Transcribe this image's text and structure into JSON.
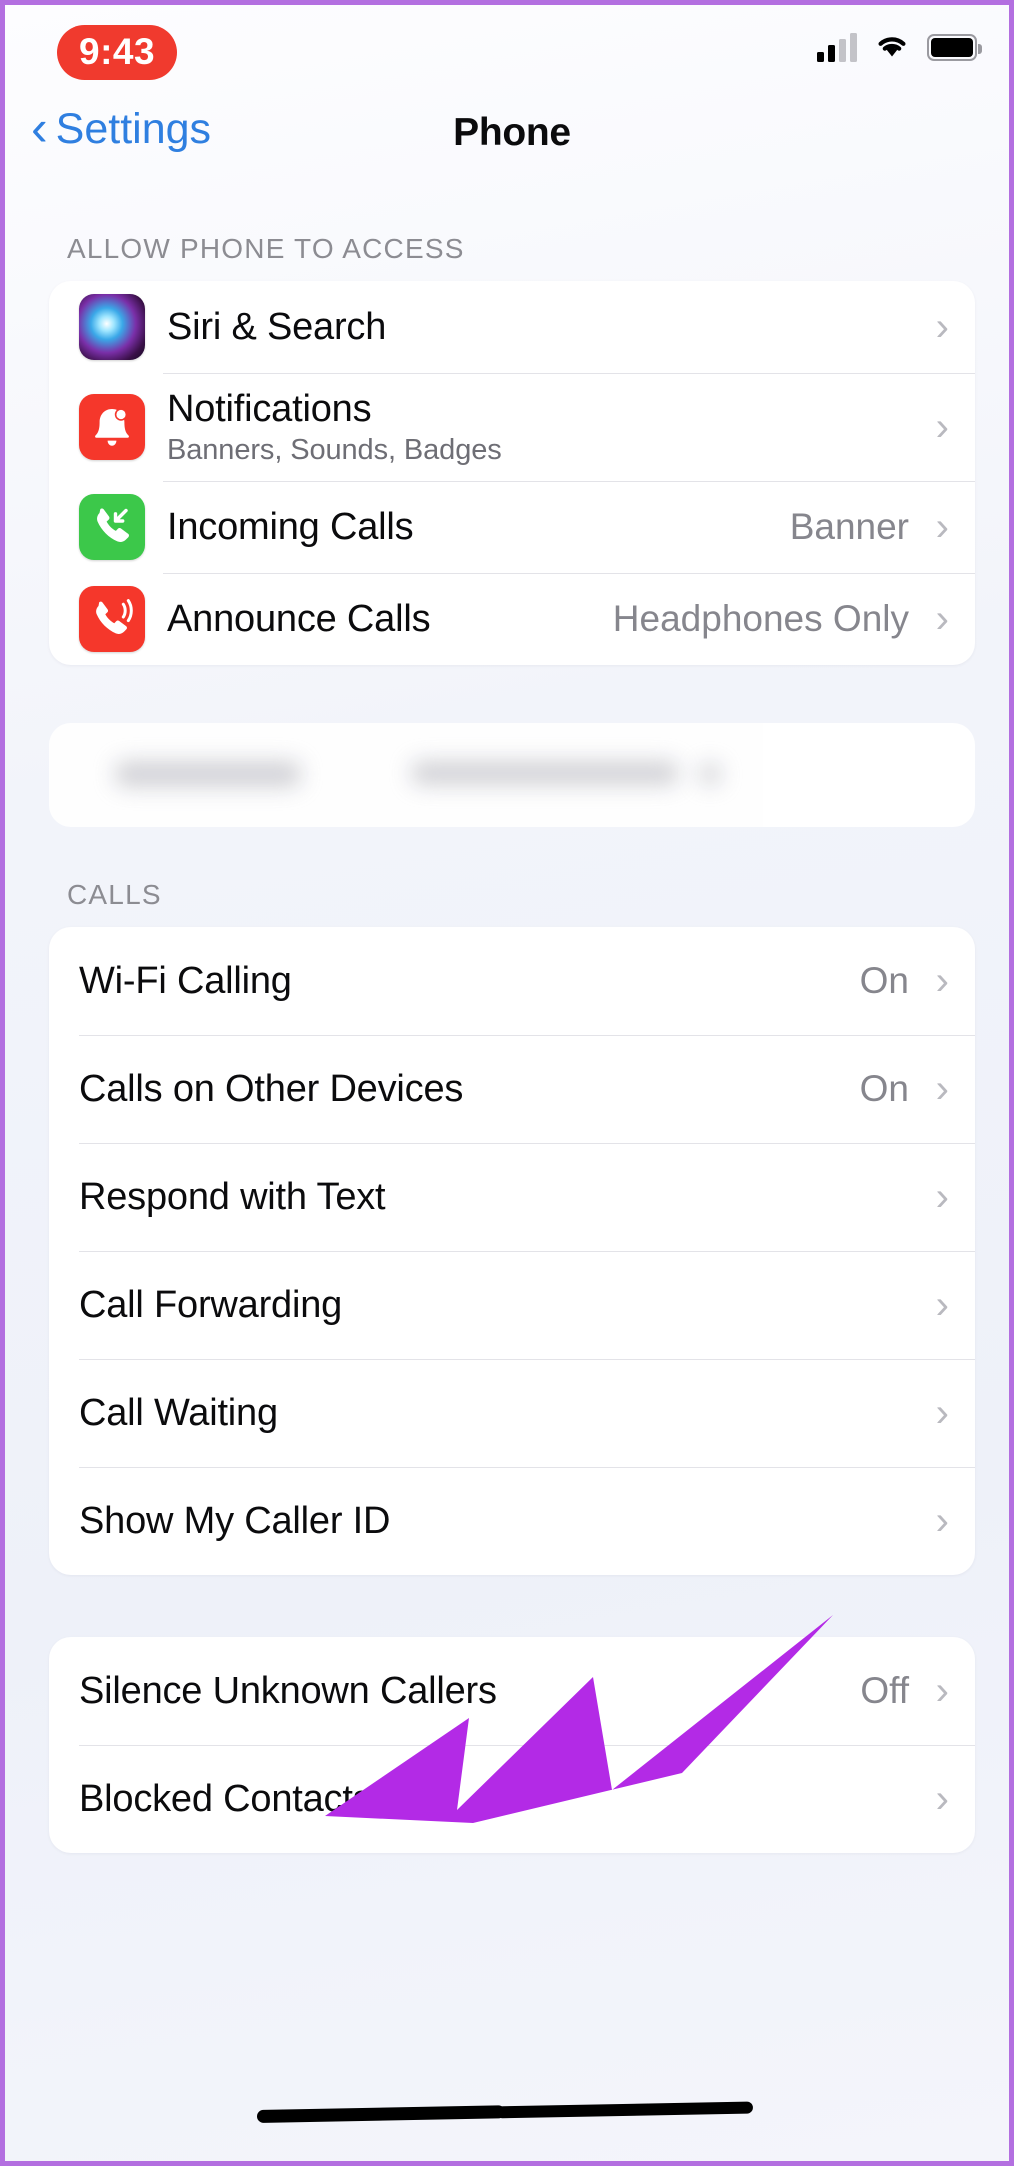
{
  "status_bar": {
    "time": "9:43",
    "icons": [
      "cellular-signal-icon",
      "wifi-icon",
      "battery-icon"
    ]
  },
  "nav": {
    "back_label": "Settings",
    "back_icon": "chevron-left-icon",
    "title": "Phone"
  },
  "sections": [
    {
      "header": "ALLOW PHONE TO ACCESS",
      "rows": [
        {
          "label": "Siri & Search",
          "subtitle": "",
          "value": "",
          "icon": "siri-icon",
          "accessory": "chevron-right-icon"
        },
        {
          "label": "Notifications",
          "subtitle": "Banners, Sounds, Badges",
          "value": "",
          "icon": "bell-icon",
          "accessory": "chevron-right-icon"
        },
        {
          "label": "Incoming Calls",
          "subtitle": "",
          "value": "Banner",
          "icon": "incoming-call-icon",
          "accessory": "chevron-right-icon"
        },
        {
          "label": "Announce Calls",
          "subtitle": "",
          "value": "Headphones Only",
          "icon": "announce-call-icon",
          "accessory": "chevron-right-icon"
        }
      ]
    },
    {
      "header": "CALLS",
      "rows": [
        {
          "label": "Wi-Fi Calling",
          "value": "On",
          "accessory": "chevron-right-icon"
        },
        {
          "label": "Calls on Other Devices",
          "value": "On",
          "accessory": "chevron-right-icon"
        },
        {
          "label": "Respond with Text",
          "value": "",
          "accessory": "chevron-right-icon"
        },
        {
          "label": "Call Forwarding",
          "value": "",
          "accessory": "chevron-right-icon"
        },
        {
          "label": "Call Waiting",
          "value": "",
          "accessory": "chevron-right-icon"
        },
        {
          "label": "Show My Caller ID",
          "value": "",
          "accessory": "chevron-right-icon"
        }
      ]
    },
    {
      "header": "",
      "rows": [
        {
          "label": "Silence Unknown Callers",
          "value": "Off",
          "accessory": "chevron-right-icon"
        },
        {
          "label": "Blocked Contacts",
          "value": "",
          "accessory": "chevron-right-icon"
        }
      ]
    }
  ],
  "annotation": {
    "arrow_color": "#b32ae6",
    "points_at": "Show My Caller ID"
  },
  "colors": {
    "accent_blue": "#2f7fe0",
    "recording_red": "#f03a2e",
    "icon_red": "#f5372b",
    "icon_green": "#3cc84a",
    "page_background": "#eef1f9",
    "card_background": "#ffffff",
    "secondary_text": "#86868d",
    "frame_border": "#b36fe0"
  }
}
